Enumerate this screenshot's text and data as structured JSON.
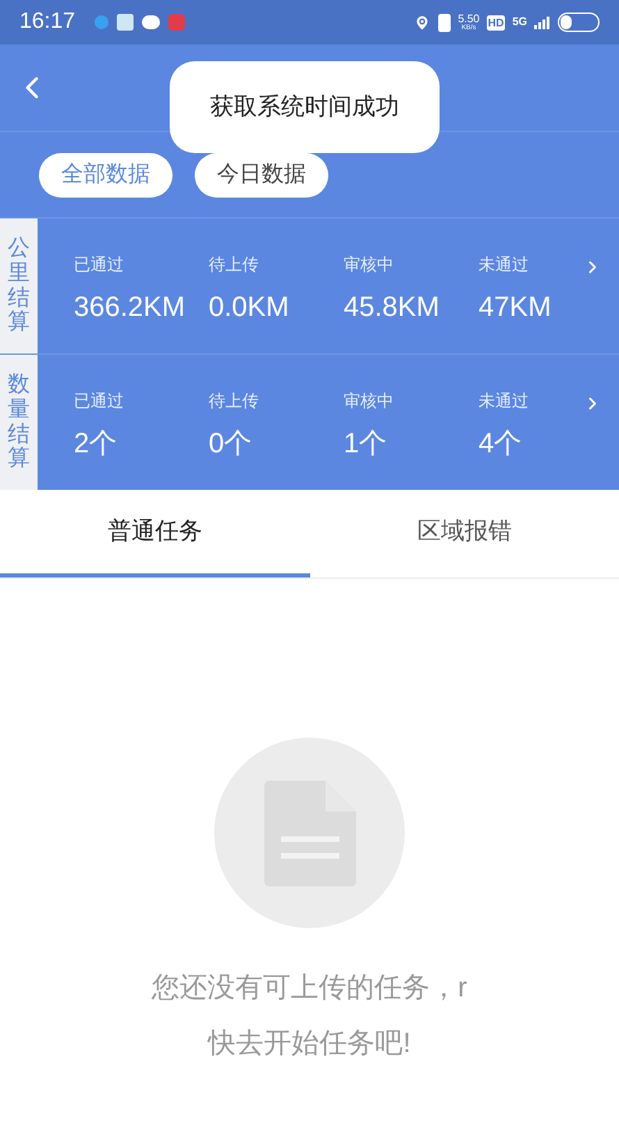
{
  "status_bar": {
    "time": "16:17",
    "speed": "5.50",
    "speed_unit": "KB/s",
    "hd": "HD",
    "network": "5G"
  },
  "toast": "获取系统时间成功",
  "filters": [
    {
      "label": "全部数据",
      "selected": true
    },
    {
      "label": "今日数据",
      "selected": false
    }
  ],
  "stats": [
    {
      "title": "公里结算",
      "items": [
        {
          "label": "已通过",
          "value": "366.2KM"
        },
        {
          "label": "待上传",
          "value": "0.0KM"
        },
        {
          "label": "审核中",
          "value": "45.8KM"
        },
        {
          "label": "未通过",
          "value": "47KM"
        }
      ]
    },
    {
      "title": "数量结算",
      "items": [
        {
          "label": "已通过",
          "value": "2个"
        },
        {
          "label": "待上传",
          "value": "0个"
        },
        {
          "label": "审核中",
          "value": "1个"
        },
        {
          "label": "未通过",
          "value": "4个"
        }
      ]
    }
  ],
  "tabs": [
    {
      "label": "普通任务",
      "selected": true
    },
    {
      "label": "区域报错",
      "selected": false
    }
  ],
  "empty_state": {
    "lines": [
      "您还没有可上传的任务，r",
      "快去开始任务吧!"
    ]
  }
}
